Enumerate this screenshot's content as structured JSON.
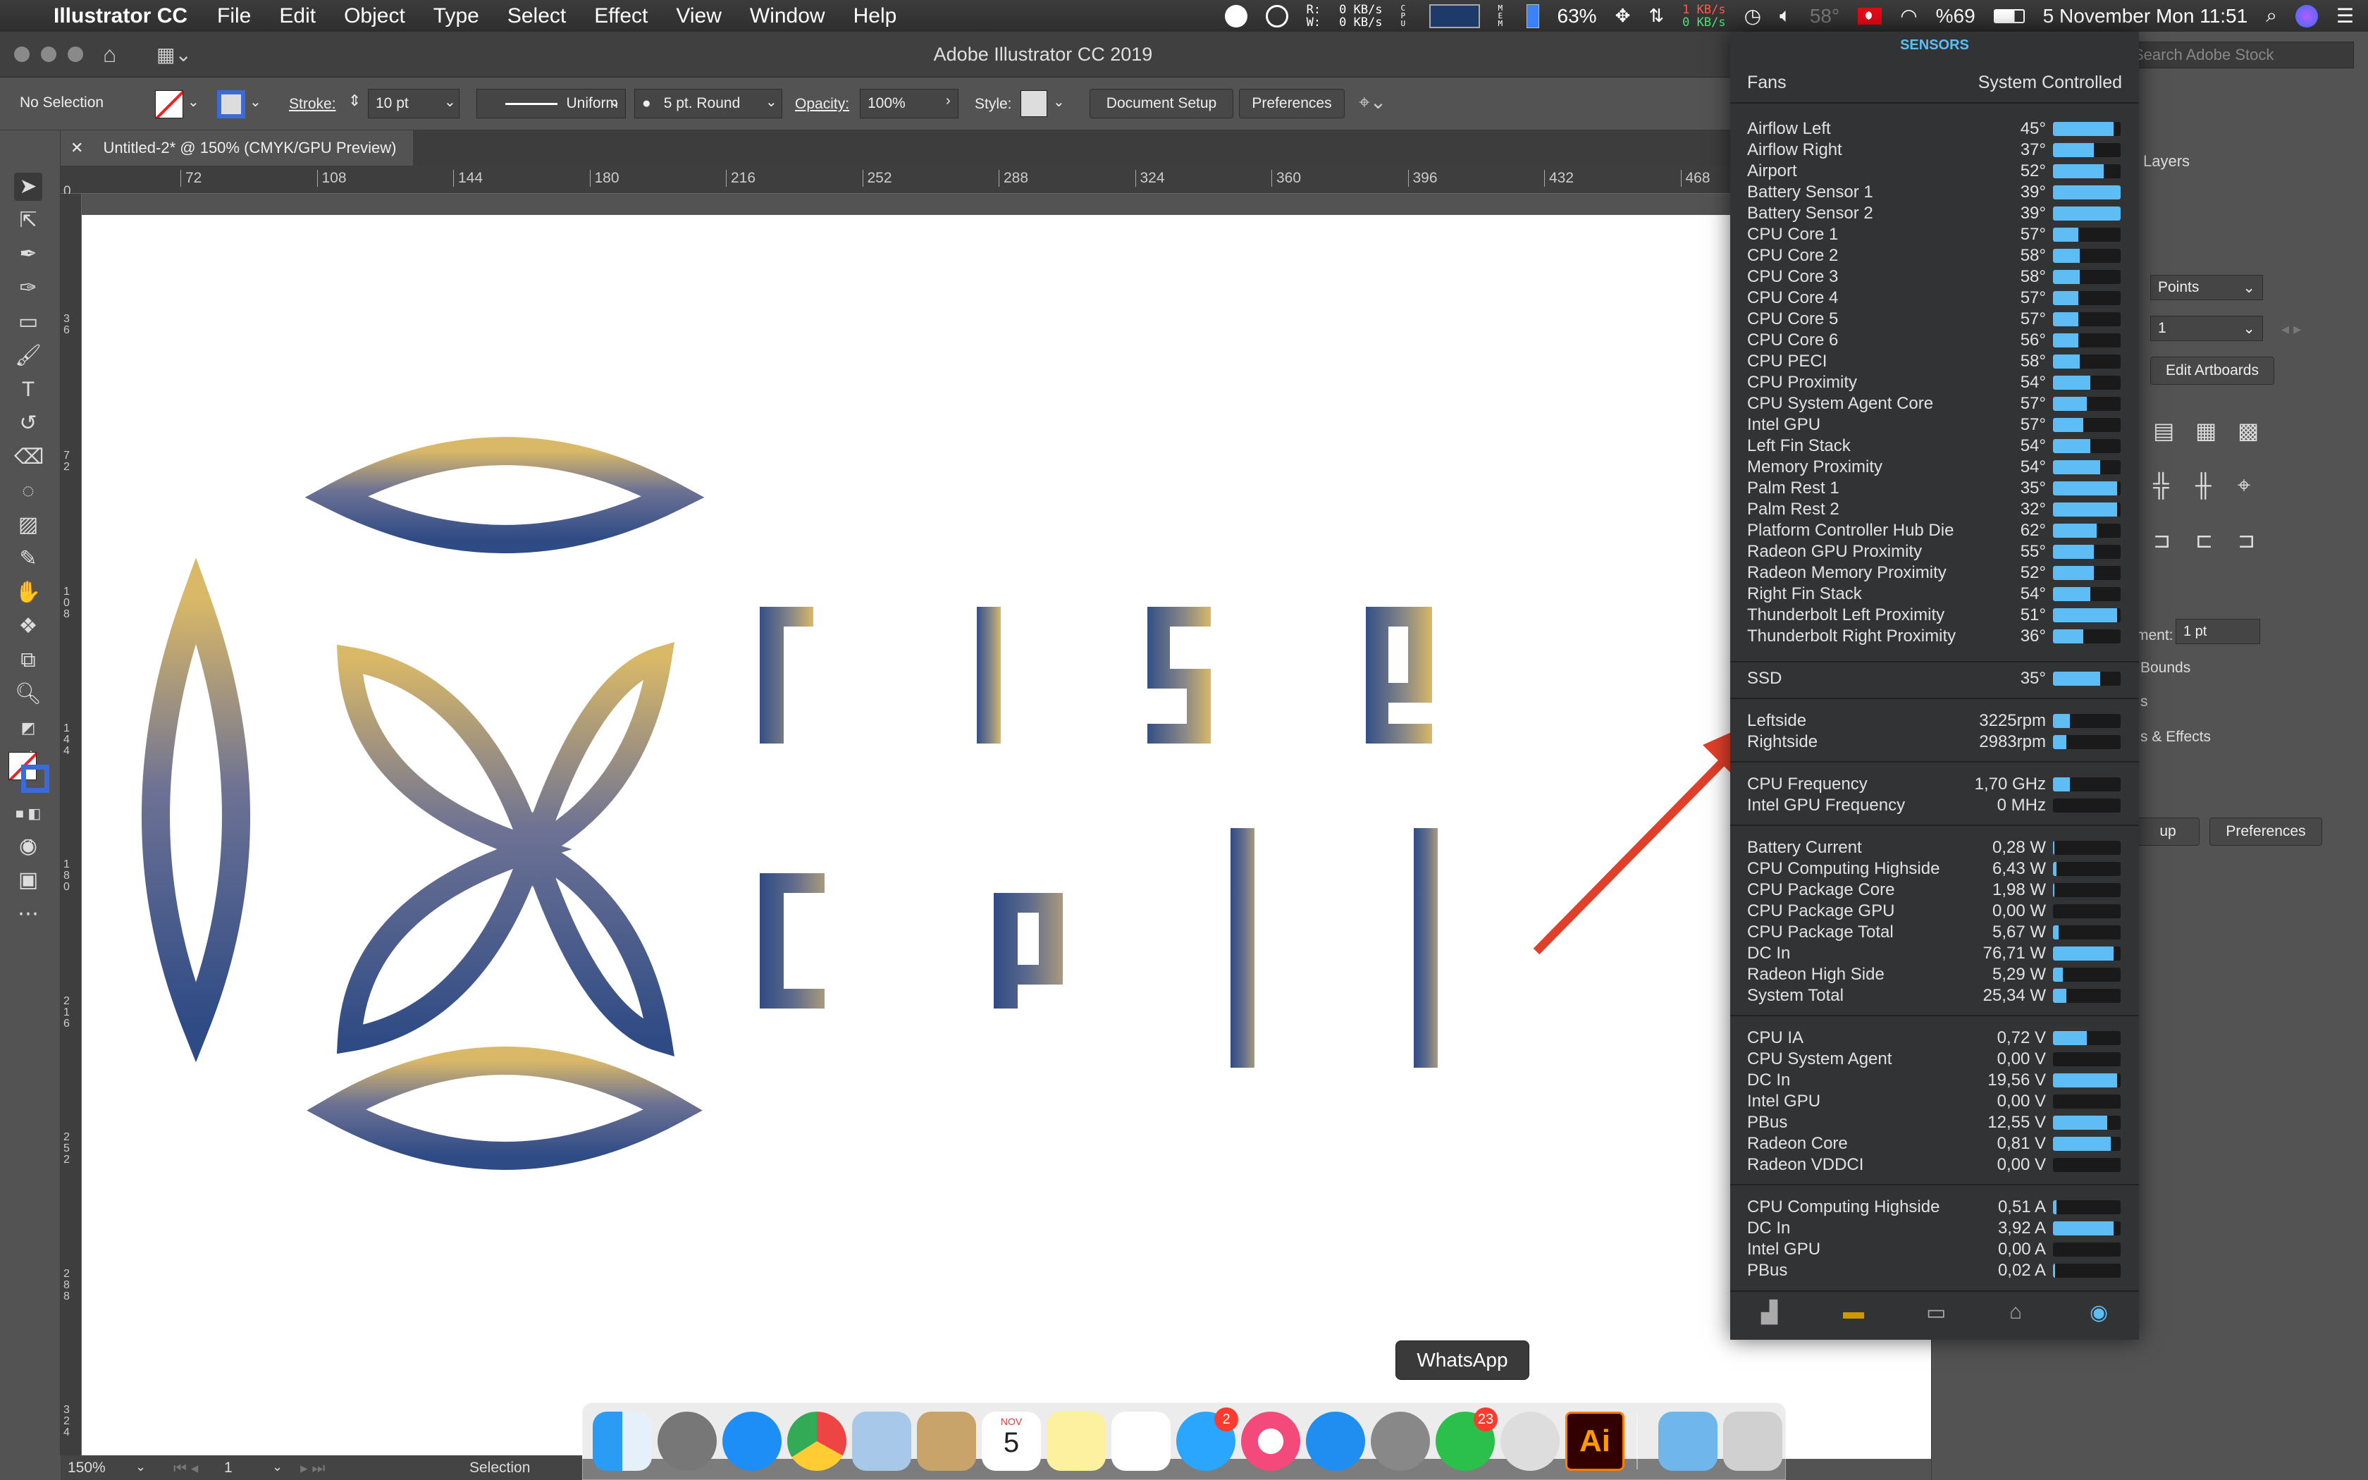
{
  "menubar": {
    "app_name": "Illustrator CC",
    "items": [
      "File",
      "Edit",
      "Object",
      "Type",
      "Select",
      "Effect",
      "View",
      "Window",
      "Help"
    ],
    "network": {
      "r": "R:",
      "w": "W:",
      "down": "0 KB/s",
      "up": "0 KB/s"
    },
    "cpu_label": "C P U",
    "mem_label": "M E M",
    "mem_pct": "63%",
    "net_rates": {
      "in": "1 KB/s",
      "out": "0 KB/s"
    },
    "temp": "58°",
    "battery": "%69",
    "datetime": "5 November Mon  11:51"
  },
  "window": {
    "title": "Adobe Illustrator CC 2019",
    "search_placeholder": "Search Adobe Stock"
  },
  "control_bar": {
    "selection": "No Selection",
    "stroke_label": "Stroke:",
    "stroke_value": "10 pt",
    "profile": "Uniform",
    "brush": "5 pt. Round",
    "opacity_label": "Opacity:",
    "opacity_value": "100%",
    "style_label": "Style:",
    "doc_setup": "Document Setup",
    "preferences": "Preferences"
  },
  "document_tab": {
    "title": "Untitled-2* @ 150% (CMYK/GPU Preview)"
  },
  "ruler": {
    "h_ticks": [
      "72",
      "108",
      "144",
      "180",
      "216",
      "252",
      "288",
      "324",
      "360",
      "396",
      "432",
      "468"
    ],
    "origin": "0",
    "v_ticks": [
      "3 6",
      "7 2",
      "1 0 8",
      "1 4 4",
      "1 8 0",
      "2 1 6",
      "2 5 2",
      "2 8 8",
      "3 2 4"
    ]
  },
  "right_panel": {
    "tab": "Layers",
    "units": "Points",
    "artboard_num": "1",
    "edit_artboards": "Edit Artboards",
    "align_label": "ment:",
    "align_value": "1 pt",
    "bounds": "Bounds",
    "s_label": "s",
    "effects": "s & Effects",
    "up_label": "up",
    "preferences": "Preferences"
  },
  "sensors": {
    "header": "SENSORS",
    "fans_label": "Fans",
    "fans_mode": "System Controlled",
    "temps": [
      {
        "name": "Airflow Left",
        "value": "45°",
        "level": 0.9
      },
      {
        "name": "Airflow Right",
        "value": "37°",
        "level": 0.6
      },
      {
        "name": "Airport",
        "value": "52°",
        "level": 0.75
      },
      {
        "name": "Battery Sensor 1",
        "value": "39°",
        "level": 1.0
      },
      {
        "name": "Battery Sensor 2",
        "value": "39°",
        "level": 1.0
      },
      {
        "name": "CPU Core 1",
        "value": "57°",
        "level": 0.38
      },
      {
        "name": "CPU Core 2",
        "value": "58°",
        "level": 0.4
      },
      {
        "name": "CPU Core 3",
        "value": "58°",
        "level": 0.4
      },
      {
        "name": "CPU Core 4",
        "value": "57°",
        "level": 0.38
      },
      {
        "name": "CPU Core 5",
        "value": "57°",
        "level": 0.38
      },
      {
        "name": "CPU Core 6",
        "value": "56°",
        "level": 0.38
      },
      {
        "name": "CPU PECI",
        "value": "58°",
        "level": 0.4
      },
      {
        "name": "CPU Proximity",
        "value": "54°",
        "level": 0.55
      },
      {
        "name": "CPU System Agent Core",
        "value": "57°",
        "level": 0.5
      },
      {
        "name": "Intel GPU",
        "value": "57°",
        "level": 0.45
      },
      {
        "name": "Left Fin Stack",
        "value": "54°",
        "level": 0.55
      },
      {
        "name": "Memory Proximity",
        "value": "54°",
        "level": 0.7
      },
      {
        "name": "Palm Rest 1",
        "value": "35°",
        "level": 0.95
      },
      {
        "name": "Palm Rest 2",
        "value": "32°",
        "level": 0.95
      },
      {
        "name": "Platform Controller Hub Die",
        "value": "62°",
        "level": 0.65
      },
      {
        "name": "Radeon GPU Proximity",
        "value": "55°",
        "level": 0.6
      },
      {
        "name": "Radeon Memory Proximity",
        "value": "52°",
        "level": 0.6
      },
      {
        "name": "Right Fin Stack",
        "value": "54°",
        "level": 0.55
      },
      {
        "name": "Thunderbolt Left Proximity",
        "value": "51°",
        "level": 0.95
      },
      {
        "name": "Thunderbolt Right Proximity",
        "value": "36°",
        "level": 0.45
      }
    ],
    "ssd": {
      "name": "SSD",
      "value": "35°",
      "level": 0.7
    },
    "fans": [
      {
        "name": "Leftside",
        "value": "3225rpm",
        "level": 0.25
      },
      {
        "name": "Rightside",
        "value": "2983rpm",
        "level": 0.2
      }
    ],
    "freq": [
      {
        "name": "CPU Frequency",
        "value": "1,70 GHz",
        "level": 0.25
      },
      {
        "name": "Intel GPU Frequency",
        "value": "0 MHz",
        "level": 0
      }
    ],
    "power": [
      {
        "name": "Battery Current",
        "value": "0,28 W",
        "level": 0.02
      },
      {
        "name": "CPU Computing Highside",
        "value": "6,43 W",
        "level": 0.05
      },
      {
        "name": "CPU Package Core",
        "value": "1,98 W",
        "level": 0.02
      },
      {
        "name": "CPU Package GPU",
        "value": "0,00 W",
        "level": 0.0
      },
      {
        "name": "CPU Package Total",
        "value": "5,67 W",
        "level": 0.08
      },
      {
        "name": "DC In",
        "value": "76,71 W",
        "level": 0.9
      },
      {
        "name": "Radeon High Side",
        "value": "5,29 W",
        "level": 0.15
      },
      {
        "name": "System Total",
        "value": "25,34 W",
        "level": 0.2
      }
    ],
    "voltage": [
      {
        "name": "CPU IA",
        "value": "0,72 V",
        "level": 0.5
      },
      {
        "name": "CPU System Agent",
        "value": "0,00 V",
        "level": 0
      },
      {
        "name": "DC In",
        "value": "19,56 V",
        "level": 0.95
      },
      {
        "name": "Intel GPU",
        "value": "0,00 V",
        "level": 0
      },
      {
        "name": "PBus",
        "value": "12,55 V",
        "level": 0.8
      },
      {
        "name": "Radeon Core",
        "value": "0,81 V",
        "level": 0.85
      },
      {
        "name": "Radeon VDDCI",
        "value": "0,00 V",
        "level": 0
      }
    ],
    "current": [
      {
        "name": "CPU Computing Highside",
        "value": "0,51 A",
        "level": 0.05
      },
      {
        "name": "DC In",
        "value": "3,92 A",
        "level": 0.9
      },
      {
        "name": "Intel GPU",
        "value": "0,00 A",
        "level": 0
      },
      {
        "name": "PBus",
        "value": "0,02 A",
        "level": 0.03
      }
    ]
  },
  "dock": {
    "tooltip": "WhatsApp",
    "messages_badge": "2",
    "whatsapp_badge": "23",
    "calendar_month": "NOV",
    "calendar_day": "5",
    "ai_label": "Ai"
  },
  "status_bar": {
    "zoom": "150%",
    "artboard": "1",
    "tool": "Selection"
  },
  "colors": {
    "accent": "#5fbdf5",
    "arrow": "#e0402a",
    "logo_gold": "#d9b867",
    "logo_blue": "#2f4b85"
  }
}
